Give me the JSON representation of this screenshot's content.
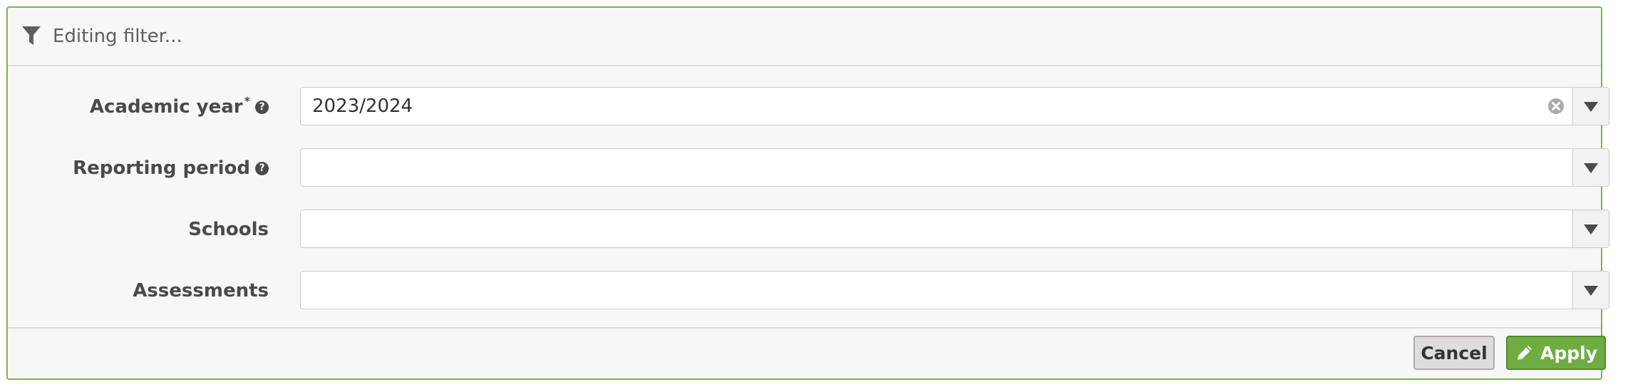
{
  "header": {
    "icon": "filter-icon",
    "title": "Editing filter..."
  },
  "fields": [
    {
      "label": "Academic year",
      "required_mark": "*",
      "has_help": true,
      "value": "2023/2024",
      "clearable": true
    },
    {
      "label": "Reporting period",
      "required_mark": "",
      "has_help": true,
      "value": "",
      "clearable": false
    },
    {
      "label": "Schools",
      "required_mark": "",
      "has_help": false,
      "value": "",
      "clearable": false
    },
    {
      "label": "Assessments",
      "required_mark": "",
      "has_help": false,
      "value": "",
      "clearable": false
    }
  ],
  "footer": {
    "cancel_label": "Cancel",
    "apply_label": "Apply",
    "apply_icon": "pencil-icon"
  },
  "colors": {
    "panel_border": "#7ab648",
    "apply_bg": "#6fad43",
    "cancel_bg": "#dddddd"
  }
}
